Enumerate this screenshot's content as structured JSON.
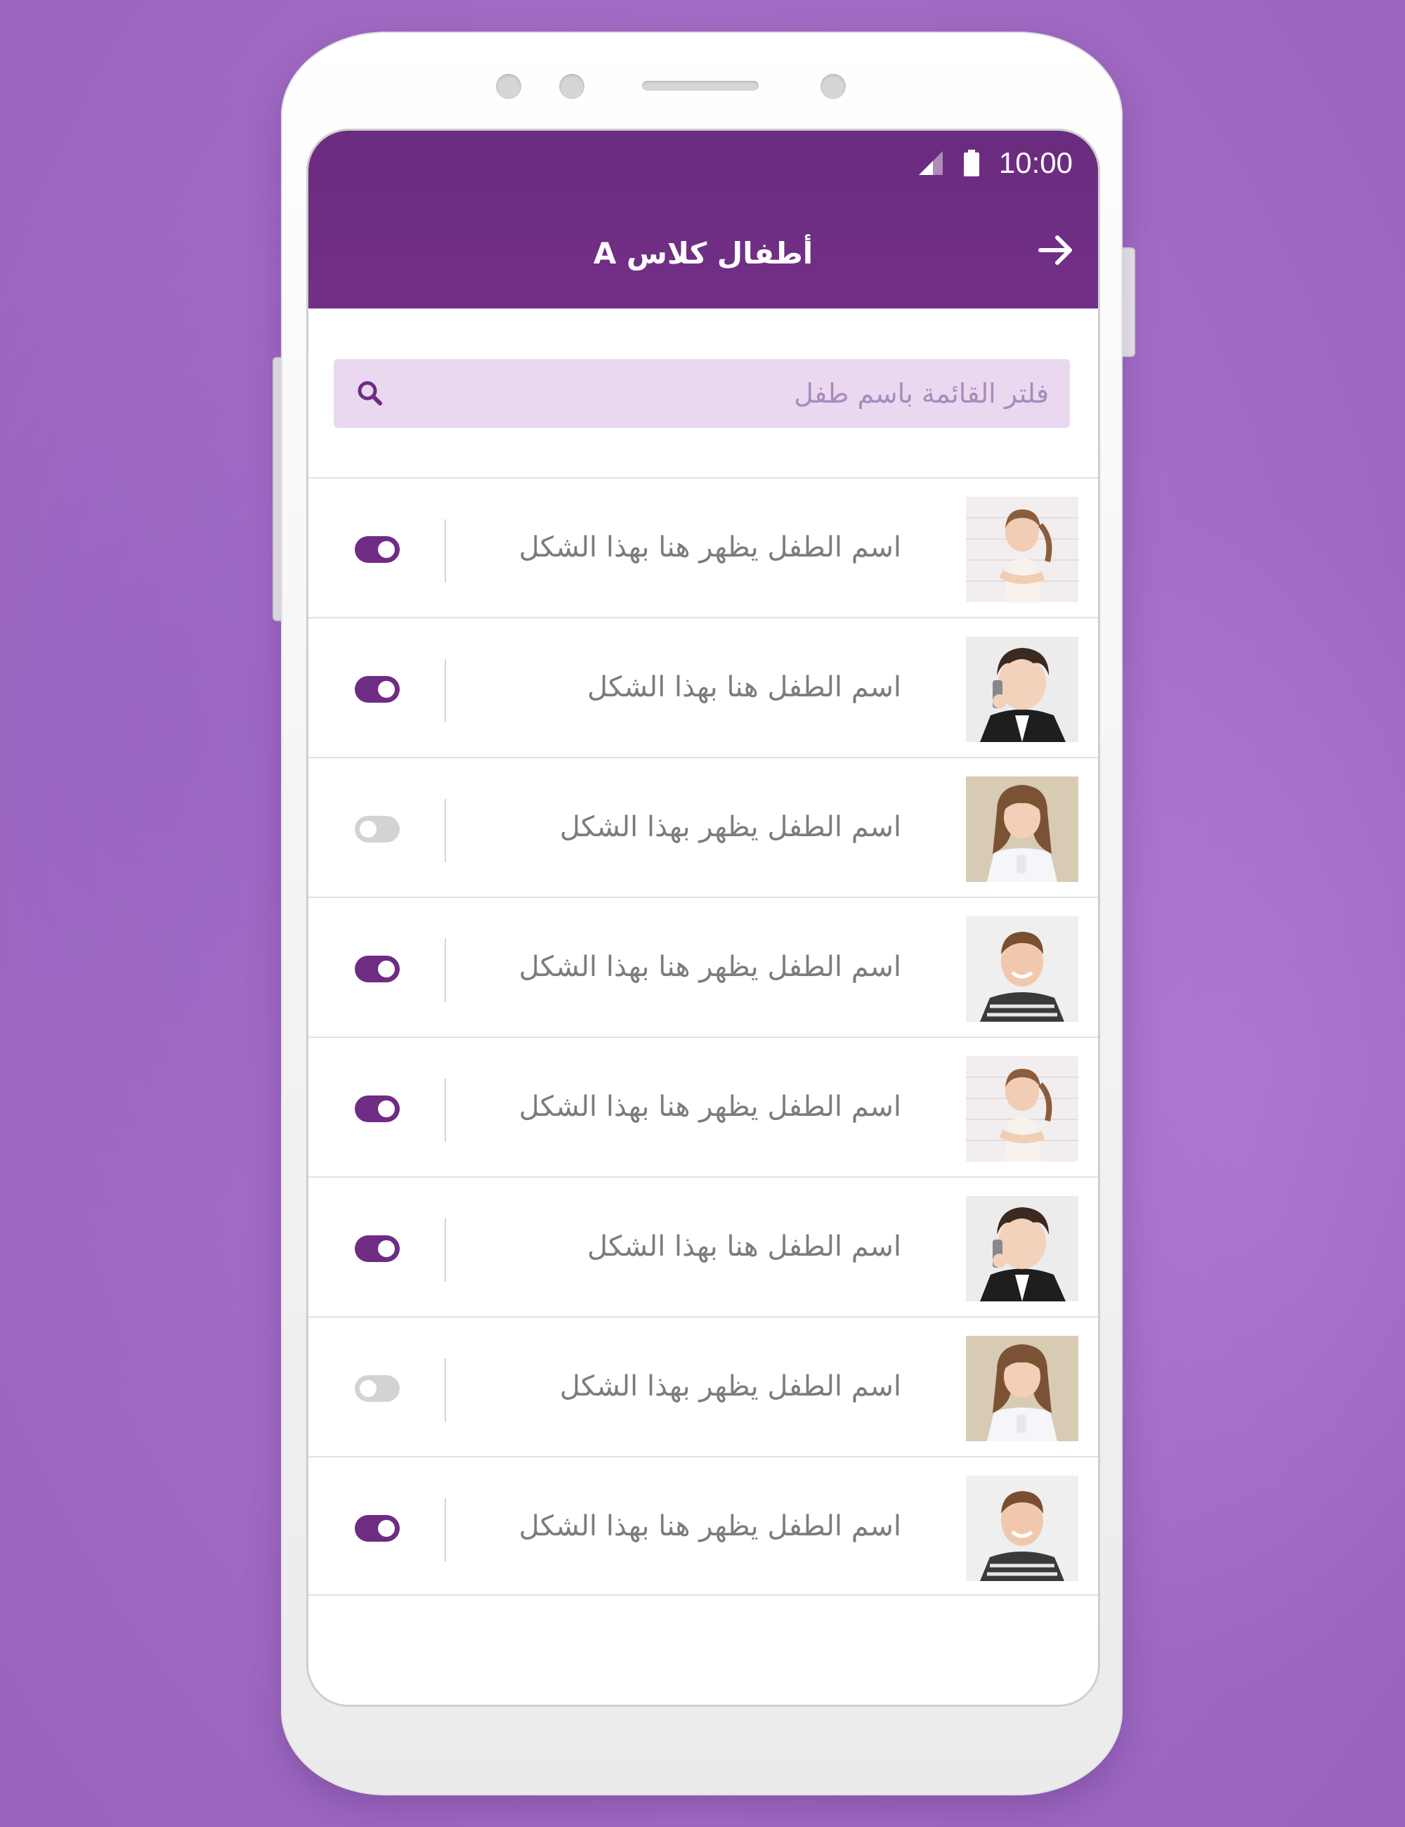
{
  "status_bar": {
    "time": "10:00",
    "signal_icon": "signal-icon",
    "battery_icon": "battery-icon"
  },
  "header": {
    "title": "أطفال كلاس A",
    "back_icon": "arrow-right-icon"
  },
  "search": {
    "placeholder": "فلتر القائمة باسم طفل",
    "value": "",
    "icon": "search-icon"
  },
  "colors": {
    "primary": "#6e2c82",
    "search_bg": "#e9d8f0",
    "toggle_off": "#d3d3d3",
    "background": "#a56fc8"
  },
  "children": [
    {
      "name": "اسم الطفل يظهر هنا بهذا الشكل",
      "enabled": true,
      "photo": "girl-pigtails"
    },
    {
      "name": "اسم الطفل هنا بهذا الشكل",
      "enabled": true,
      "photo": "boy-phone"
    },
    {
      "name": "اسم الطفل يظهر بهذا الشكل",
      "enabled": false,
      "photo": "girl-curly"
    },
    {
      "name": "اسم الطفل يظهر هنا بهذا الشكل",
      "enabled": true,
      "photo": "boy-smiling"
    },
    {
      "name": "اسم الطفل يظهر هنا بهذا الشكل",
      "enabled": true,
      "photo": "girl-pigtails"
    },
    {
      "name": "اسم الطفل هنا بهذا الشكل",
      "enabled": true,
      "photo": "boy-phone"
    },
    {
      "name": "اسم الطفل يظهر بهذا الشكل",
      "enabled": false,
      "photo": "girl-curly"
    },
    {
      "name": "اسم الطفل يظهر هنا بهذا الشكل",
      "enabled": true,
      "photo": "boy-smiling"
    }
  ]
}
